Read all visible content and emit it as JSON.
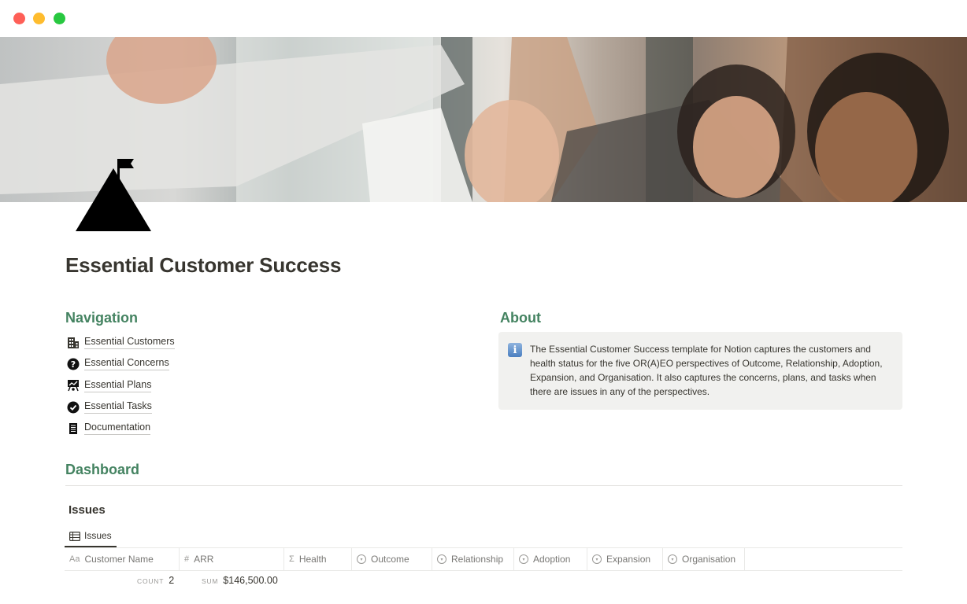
{
  "window": {
    "buttons": [
      "close",
      "minimize",
      "zoom"
    ]
  },
  "page": {
    "title": "Essential Customer Success",
    "icon": "mountain-flag-icon"
  },
  "navigation": {
    "heading": "Navigation",
    "items": [
      {
        "label": "Essential Customers",
        "icon": "building-icon"
      },
      {
        "label": "Essential Concerns",
        "icon": "question-circle-icon"
      },
      {
        "label": "Essential Plans",
        "icon": "presentation-board-icon"
      },
      {
        "label": "Essential Tasks",
        "icon": "check-circle-icon"
      },
      {
        "label": "Documentation",
        "icon": "document-icon"
      }
    ]
  },
  "about": {
    "heading": "About",
    "icon": "info-icon",
    "icon_glyph": "i",
    "text": "The Essential Customer Success template for Notion captures the customers and health status for the five OR(A)EO perspectives of Outcome, Relationship, Adoption, Expansion, and Organisation. It also captures the concerns, plans, and tasks  when there are issues in any of the perspectives."
  },
  "dashboard": {
    "heading": "Dashboard",
    "database_title": "Issues",
    "view_tab": "Issues",
    "columns": [
      {
        "label": "Customer Name",
        "icon_text": "Aa"
      },
      {
        "label": "ARR",
        "icon_text": "#"
      },
      {
        "label": "Health",
        "icon_text": "Σ"
      },
      {
        "label": "Outcome",
        "icon_text": "▾"
      },
      {
        "label": "Relationship",
        "icon_text": "▾"
      },
      {
        "label": "Adoption",
        "icon_text": "▾"
      },
      {
        "label": "Expansion",
        "icon_text": "▾"
      },
      {
        "label": "Organisation",
        "icon_text": "▾"
      }
    ],
    "footer": {
      "count_label": "COUNT",
      "count_value": "2",
      "sum_label": "SUM",
      "sum_value": "$146,500.00"
    }
  },
  "colors": {
    "heading_green": "#448361",
    "text": "#37352f",
    "callout_bg": "#f1f1ef"
  }
}
